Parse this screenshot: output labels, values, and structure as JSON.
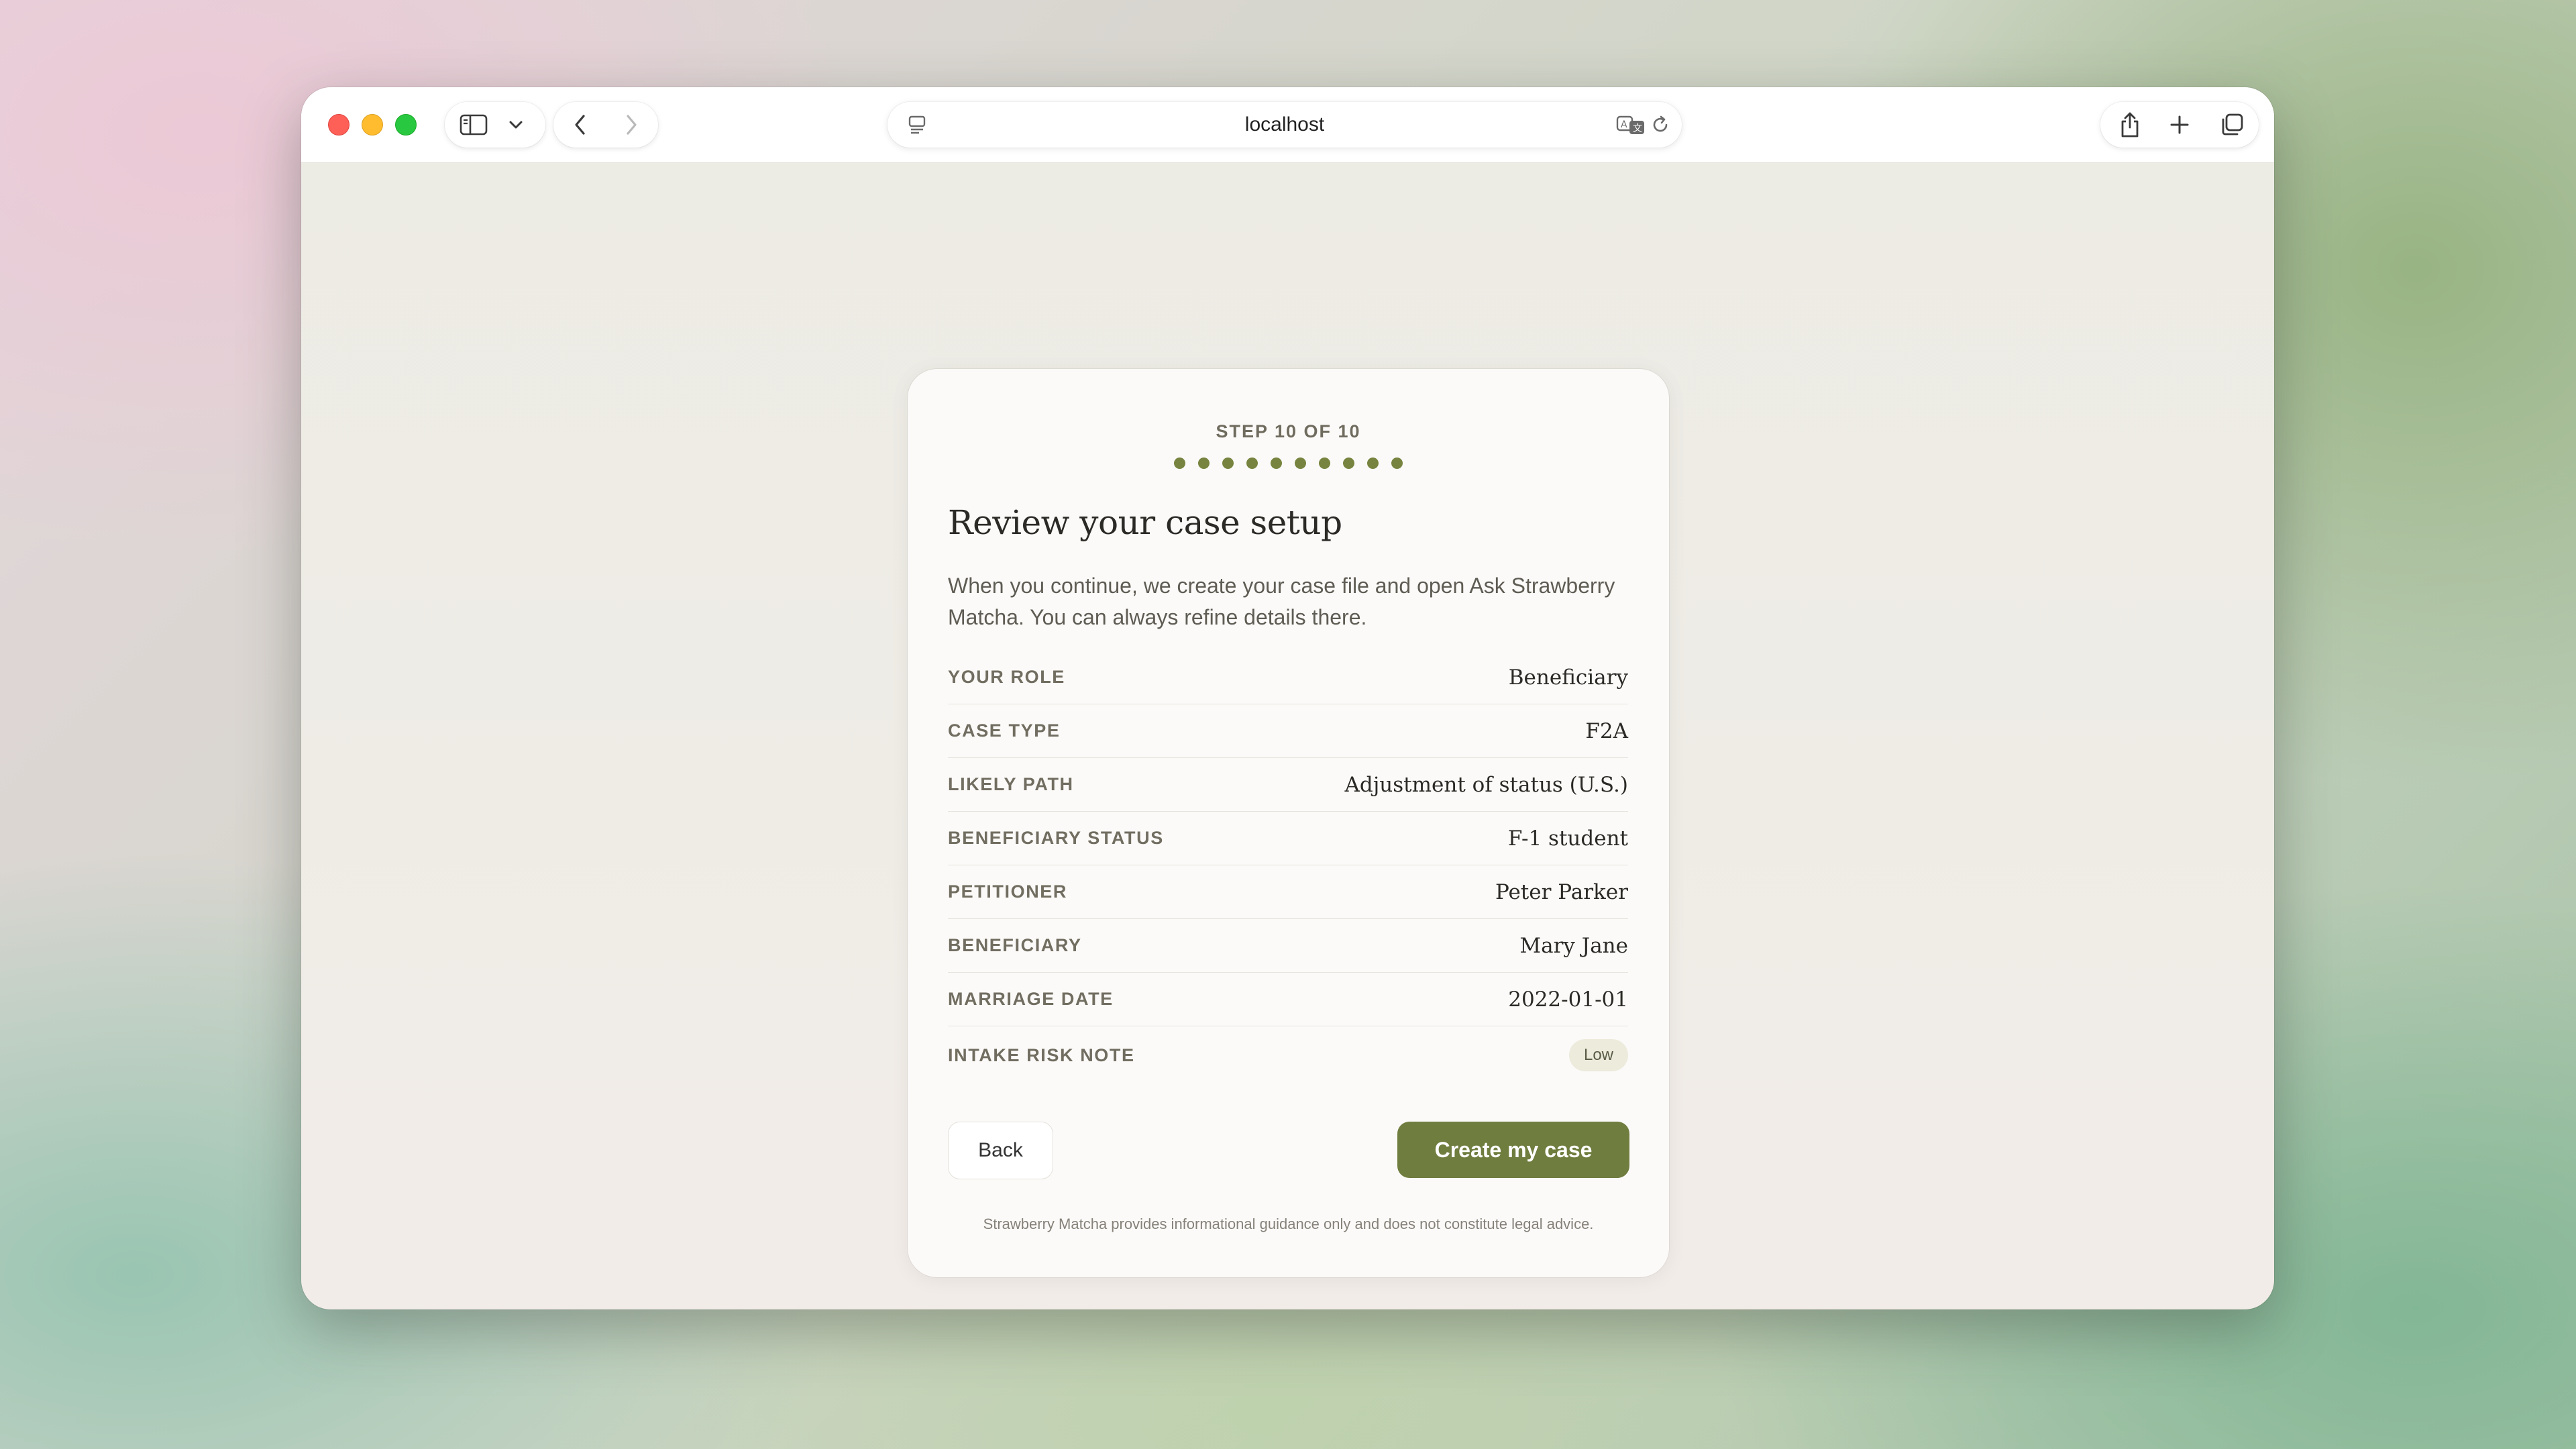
{
  "browser": {
    "url": "localhost"
  },
  "wizard": {
    "step_label": "STEP 10 OF 10",
    "total_steps": 10,
    "current_step": 10,
    "title": "Review your case setup",
    "description": "When you continue, we create your case file and open Ask Strawberry Matcha. You can always refine details there.",
    "rows": [
      {
        "label": "YOUR ROLE",
        "value": "Beneficiary"
      },
      {
        "label": "CASE TYPE",
        "value": "F2A"
      },
      {
        "label": "LIKELY PATH",
        "value": "Adjustment of status (U.S.)"
      },
      {
        "label": "BENEFICIARY STATUS",
        "value": "F-1 student"
      },
      {
        "label": "PETITIONER",
        "value": "Peter Parker"
      },
      {
        "label": "BENEFICIARY",
        "value": "Mary Jane"
      },
      {
        "label": "MARRIAGE DATE",
        "value": "2022-01-01"
      }
    ],
    "risk": {
      "label": "INTAKE RISK NOTE",
      "badge": "Low"
    },
    "back_label": "Back",
    "create_label": "Create my case",
    "disclaimer": "Strawberry Matcha provides informational guidance only and does not constitute legal advice."
  },
  "colors": {
    "accent": "#6f7d3f",
    "dot": "#77843f",
    "badge_bg": "#ecebdc"
  }
}
